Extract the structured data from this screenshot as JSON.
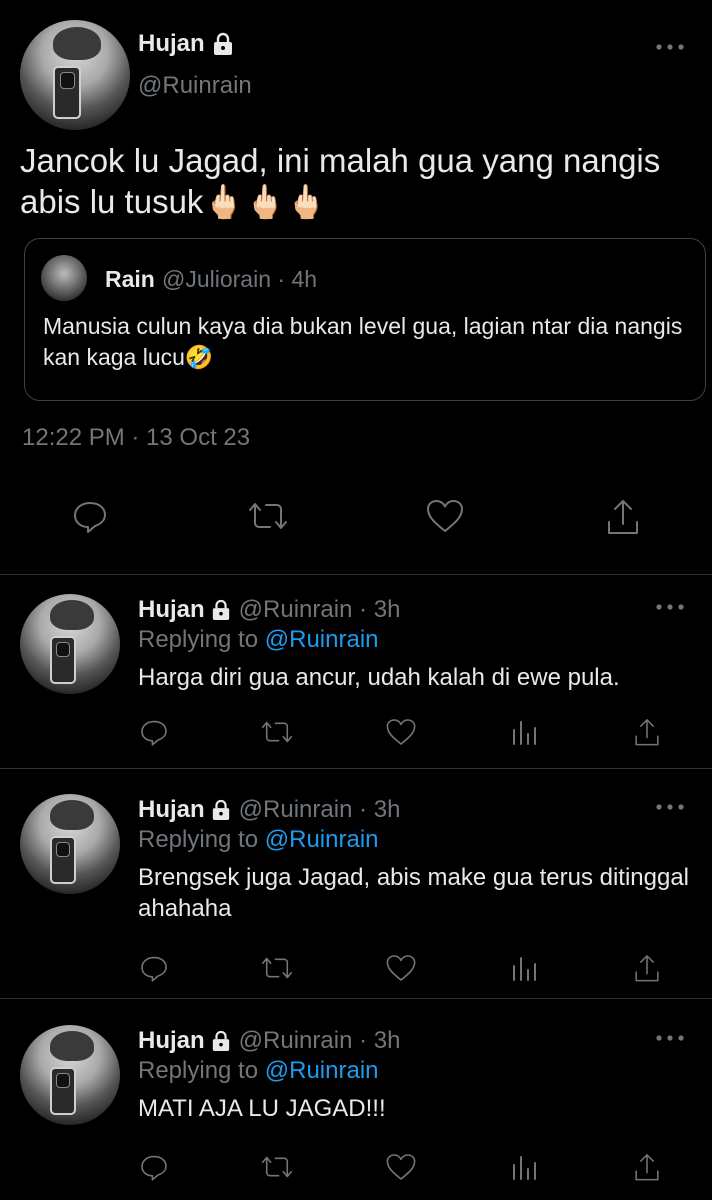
{
  "main_tweet": {
    "name": "Hujan",
    "handle": "@Ruinrain",
    "text": "Jancok lu Jagad, ini malah gua yang nangis abis lu tusuk🖕🏻🖕🏻🖕🏻",
    "quote": {
      "name": "Rain",
      "handle_time": "@Juliorain · 4h",
      "text": "Manusia culun kaya dia bukan level gua, lagian ntar dia nangis kan kaga lucu🤣"
    },
    "timestamp": "12:22 PM · 13 Oct 23",
    "icons": [
      "reply-icon",
      "retweet-icon",
      "like-icon",
      "share-icon"
    ]
  },
  "replies": [
    {
      "name": "Hujan",
      "handle_time": "@Ruinrain · 3h",
      "replying_prefix": "Replying to",
      "replying_handle": "@Ruinrain",
      "text": "Harga diri gua ancur, udah kalah di ewe pula."
    },
    {
      "name": "Hujan",
      "handle_time": "@Ruinrain · 3h",
      "replying_prefix": "Replying to",
      "replying_handle": "@Ruinrain",
      "text": "Brengsek juga Jagad, abis make gua terus ditinggal ahahaha"
    },
    {
      "name": "Hujan",
      "handle_time": "@Ruinrain · 3h",
      "replying_prefix": "Replying to",
      "replying_handle": "@Ruinrain",
      "text": "MATI AJA LU JAGAD!!!"
    }
  ],
  "colors": {
    "background": "#000000",
    "text": "#e7e9ea",
    "secondary": "#71767b",
    "link": "#1d9bf0",
    "divider": "#2f3336"
  }
}
